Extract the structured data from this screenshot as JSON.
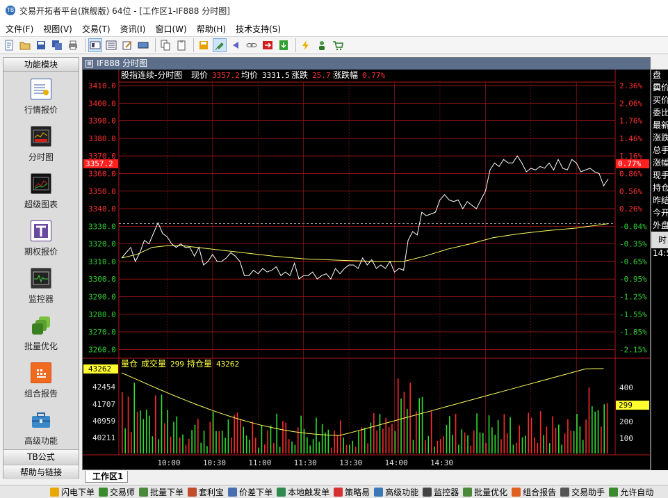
{
  "window": {
    "title": "交易开拓者平台(旗舰版) 64位 - [工作区1-IF888 分时图]"
  },
  "menu": [
    "文件(F)",
    "视图(V)",
    "交易(T)",
    "资讯(I)",
    "窗口(W)",
    "帮助(H)",
    "技术支持(S)"
  ],
  "sidebar": {
    "header": "功能模块",
    "modules": [
      {
        "label": "行情报价",
        "icon": "quote-icon"
      },
      {
        "label": "分时图",
        "icon": "intraday-chart-icon"
      },
      {
        "label": "超级图表",
        "icon": "super-chart-icon"
      },
      {
        "label": "期权报价",
        "icon": "option-quote-icon"
      },
      {
        "label": "监控器",
        "icon": "monitor-icon"
      },
      {
        "label": "批量优化",
        "icon": "batch-optimize-icon"
      },
      {
        "label": "组合报告",
        "icon": "portfolio-report-icon"
      },
      {
        "label": "高级功能",
        "icon": "advanced-toolbox-icon"
      }
    ],
    "footer1": "TB公式",
    "footer2": "帮助与链接"
  },
  "chart_window": {
    "tab_title": "IF888 分时图",
    "header": {
      "name": "股指连续-分时图",
      "price_label": "现价",
      "price_value": "3357.2",
      "avg_label": "均价",
      "avg_value": "3331.5",
      "change_label": "涨跌",
      "change_value": "25.7",
      "pct_label": "涨跌幅",
      "pct_value": "0.77%"
    },
    "volume_header": {
      "label": "量仓",
      "vol_label": "成交量",
      "vol_value": "299",
      "oi_label": "持仓量",
      "oi_value": "43262"
    },
    "current_price_tag": "3357.2",
    "current_pct_tag": "0.77%",
    "current_oi_tag": "43262",
    "current_vol_tag": "299"
  },
  "right_panel": {
    "header": "盘口",
    "rows": [
      "卖价",
      "买价",
      "委比",
      "最新",
      "涨跌",
      "总手",
      "涨幅",
      "现手",
      "持仓",
      "昨结",
      "今开",
      "外盘"
    ],
    "time_header": "时",
    "time_value": "14:5"
  },
  "workspace_tab": "工作区1",
  "taskbar": [
    {
      "label": "闪电下单",
      "icon": "lightning-icon",
      "color": "#e8a800"
    },
    {
      "label": "交易师",
      "icon": "trader-icon",
      "color": "#3b8a2f"
    },
    {
      "label": "批量下单",
      "icon": "batch-order-icon",
      "color": "#4a8a3a"
    },
    {
      "label": "套利宝",
      "icon": "arbitrage-icon",
      "color": "#c24d2c"
    },
    {
      "label": "价差下单",
      "icon": "spread-order-icon",
      "color": "#4a6fb0"
    },
    {
      "label": "本地触发单",
      "icon": "local-trigger-icon",
      "color": "#2f8a4f"
    },
    {
      "label": "策略易",
      "icon": "strategy-icon",
      "color": "#d83030"
    },
    {
      "label": "高级功能",
      "icon": "advanced-icon",
      "color": "#3a78b8"
    },
    {
      "label": "监控器",
      "icon": "monitor-icon",
      "color": "#444"
    },
    {
      "label": "批量优化",
      "icon": "batch-optimize-icon",
      "color": "#4a8a3a"
    },
    {
      "label": "组合报告",
      "icon": "portfolio-icon",
      "color": "#e06020"
    },
    {
      "label": "交易助手",
      "icon": "assistant-icon",
      "color": "#555"
    },
    {
      "label": "允许自动",
      "icon": "auto-icon",
      "color": "#3b8a2f"
    }
  ],
  "chart_data": {
    "type": "line",
    "title": "股指连续-分时图",
    "price_axis": {
      "ticks": [
        3410.0,
        3400.0,
        3390.0,
        3380.0,
        3370.0,
        3360.0,
        3350.0,
        3340.0,
        3330.0,
        3320.0,
        3310.0,
        3300.0,
        3290.0,
        3280.0,
        3270.0,
        3260.0
      ],
      "ylim": [
        3255,
        3412
      ],
      "pct_ticks": [
        "2.36%",
        "2.06%",
        "1.76%",
        "1.46%",
        "1.16%",
        "0.86%",
        "0.56%",
        "0.26%",
        "-0.04%",
        "-0.35%",
        "-0.65%",
        "-0.95%",
        "-1.25%",
        "-1.55%",
        "-1.85%",
        "-2.15%"
      ],
      "prev_settle": 3331.5
    },
    "volume_axis": {
      "oi_ticks": [
        "43262",
        "42454",
        "41707",
        "40959",
        "40211"
      ],
      "vol_ticks": [
        "400",
        "200",
        "100"
      ]
    },
    "x_ticks": [
      "10:00",
      "10:30",
      "11:00",
      "11:30",
      "13:30",
      "14:00",
      "14:30"
    ],
    "price_series": [
      [
        0,
        3312
      ],
      [
        3,
        3315
      ],
      [
        6,
        3318
      ],
      [
        9,
        3310
      ],
      [
        12,
        3315
      ],
      [
        15,
        3322
      ],
      [
        18,
        3320
      ],
      [
        21,
        3326
      ],
      [
        24,
        3332
      ],
      [
        27,
        3326
      ],
      [
        30,
        3324
      ],
      [
        33,
        3320
      ],
      [
        36,
        3318
      ],
      [
        39,
        3320
      ],
      [
        42,
        3318
      ],
      [
        45,
        3318
      ],
      [
        48,
        3313
      ],
      [
        51,
        3318
      ],
      [
        54,
        3308
      ],
      [
        57,
        3310
      ],
      [
        60,
        3314
      ],
      [
        63,
        3310
      ],
      [
        66,
        3310
      ],
      [
        69,
        3312
      ],
      [
        72,
        3315
      ],
      [
        75,
        3313
      ],
      [
        78,
        3310
      ],
      [
        81,
        3302
      ],
      [
        84,
        3302
      ],
      [
        87,
        3305
      ],
      [
        90,
        3303
      ],
      [
        93,
        3306
      ],
      [
        96,
        3304
      ],
      [
        99,
        3305
      ],
      [
        102,
        3307
      ],
      [
        105,
        3302
      ],
      [
        108,
        3304
      ],
      [
        111,
        3302
      ],
      [
        114,
        3309
      ],
      [
        117,
        3300
      ],
      [
        120,
        3302
      ],
      [
        123,
        3302
      ],
      [
        126,
        3304
      ],
      [
        129,
        3300
      ],
      [
        132,
        3302
      ],
      [
        135,
        3303
      ],
      [
        138,
        3300
      ],
      [
        141,
        3306
      ],
      [
        144,
        3303
      ],
      [
        147,
        3306
      ],
      [
        150,
        3308
      ],
      [
        153,
        3308
      ],
      [
        156,
        3306
      ],
      [
        159,
        3312
      ],
      [
        162,
        3308
      ],
      [
        165,
        3311
      ],
      [
        168,
        3306
      ],
      [
        171,
        3308
      ],
      [
        174,
        3306
      ],
      [
        177,
        3310
      ],
      [
        180,
        3304
      ],
      [
        183,
        3306
      ],
      [
        186,
        3305
      ],
      [
        189,
        3322
      ],
      [
        192,
        3327
      ],
      [
        195,
        3325
      ],
      [
        198,
        3338
      ],
      [
        201,
        3336
      ],
      [
        204,
        3337
      ],
      [
        207,
        3338
      ],
      [
        210,
        3345
      ],
      [
        213,
        3348
      ],
      [
        216,
        3345
      ],
      [
        219,
        3344
      ],
      [
        222,
        3345
      ],
      [
        225,
        3340
      ],
      [
        228,
        3344
      ],
      [
        231,
        3342
      ],
      [
        234,
        3340
      ],
      [
        237,
        3345
      ],
      [
        240,
        3350
      ],
      [
        243,
        3362
      ],
      [
        246,
        3366
      ],
      [
        249,
        3364
      ],
      [
        252,
        3368
      ],
      [
        255,
        3366
      ],
      [
        258,
        3366
      ],
      [
        261,
        3370
      ],
      [
        264,
        3366
      ],
      [
        267,
        3361
      ],
      [
        270,
        3363
      ],
      [
        273,
        3362
      ],
      [
        276,
        3364
      ],
      [
        279,
        3363
      ],
      [
        282,
        3366
      ],
      [
        285,
        3362
      ],
      [
        288,
        3368
      ],
      [
        291,
        3363
      ],
      [
        294,
        3362
      ],
      [
        297,
        3368
      ],
      [
        300,
        3366
      ],
      [
        303,
        3361
      ],
      [
        306,
        3362
      ],
      [
        309,
        3363
      ],
      [
        312,
        3361
      ],
      [
        315,
        3360
      ],
      [
        318,
        3353
      ],
      [
        321,
        3357
      ]
    ],
    "avg_series": [
      [
        0,
        3312
      ],
      [
        10,
        3314
      ],
      [
        20,
        3318
      ],
      [
        30,
        3319
      ],
      [
        40,
        3319
      ],
      [
        60,
        3317
      ],
      [
        80,
        3315
      ],
      [
        100,
        3313
      ],
      [
        120,
        3311.5
      ],
      [
        150,
        3310.5
      ],
      [
        170,
        3310
      ],
      [
        186,
        3310
      ],
      [
        200,
        3313
      ],
      [
        215,
        3317
      ],
      [
        230,
        3320
      ],
      [
        245,
        3323.5
      ],
      [
        260,
        3325.5
      ],
      [
        280,
        3327.5
      ],
      [
        300,
        3329
      ],
      [
        321,
        3331.5
      ]
    ]
  }
}
